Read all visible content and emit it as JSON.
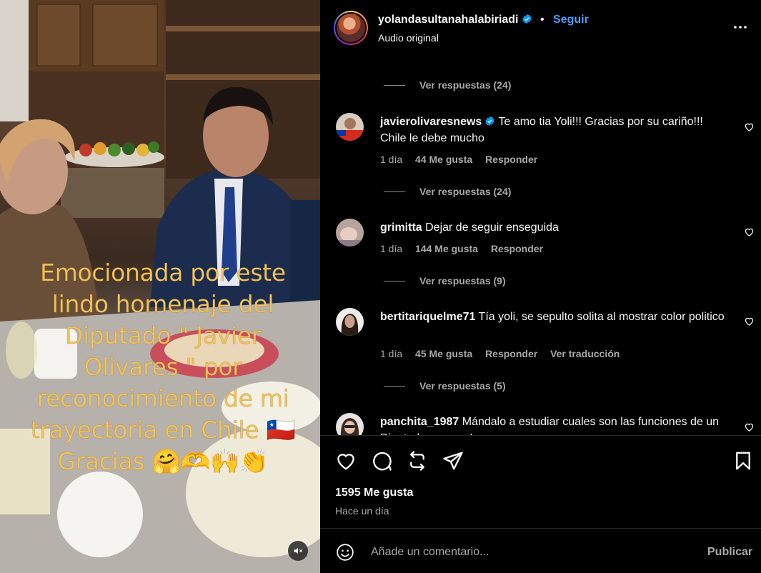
{
  "colors": {
    "background": "#000000",
    "text": "#f5f5f5",
    "muted": "#a8a8a8",
    "accent_blue": "#4f9bff",
    "overlay_text": "#f2c35a"
  },
  "post": {
    "overlay_text": "Emocionada por este lindo  homenaje del Diputado \" Javier Olivares \" por reconocimiento de mi trayectoria en Chile 🇨🇱 Gracias 🤗🫶🙌👏",
    "mute_icon": "speaker-muted-icon"
  },
  "header": {
    "username": "yolandasultanahalabiriadi",
    "dot": "•",
    "follow_label": "Seguir",
    "subtitle": "Audio original",
    "more_icon": "more-horizontal-icon"
  },
  "comments": [
    {
      "view_replies": "Ver respuestas (24)"
    },
    {
      "username": "javierolivaresnews",
      "verified": true,
      "text": "Te amo tia Yoli!!! Gracias por su cariño!!! Chile le debe mucho",
      "time": "1 día",
      "likes": "44 Me gusta",
      "reply": "Responder",
      "view_replies": "Ver respuestas (24)"
    },
    {
      "username": "grimitta",
      "text": "Dejar de seguir enseguida",
      "time": "1 día",
      "likes": "144 Me gusta",
      "reply": "Responder",
      "view_replies": "Ver respuestas (9)"
    },
    {
      "username": "bertitariquelme71",
      "text": "Tía yoli, se sepulto solita al mostrar color politico",
      "time": "1 día",
      "likes": "45 Me gusta",
      "reply": "Responder",
      "translate": "Ver traducción",
      "view_replies": "Ver respuestas (5)"
    },
    {
      "username": "panchita_1987",
      "text": "Mándalo a estudiar cuales son las funciones de un Diputado, ¡vamos!"
    }
  ],
  "actions": {
    "like_icon": "heart-icon",
    "comment_icon": "comment-icon",
    "repost_icon": "repost-icon",
    "share_icon": "paper-plane-icon",
    "save_icon": "bookmark-icon"
  },
  "stats": {
    "likes": "1595 Me gusta",
    "time": "Hace un día"
  },
  "composer": {
    "placeholder": "Añade un comentario...",
    "publish_label": "Publicar",
    "emoji_icon": "smiley-icon"
  }
}
